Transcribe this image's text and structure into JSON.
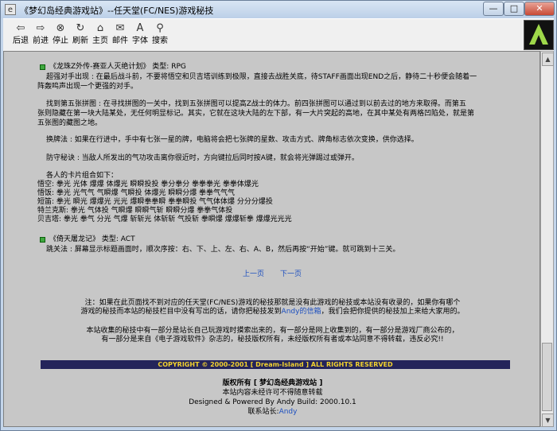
{
  "window": {
    "title": "《梦幻岛经典游戏站》--任天堂(FC/NES)游戏秘技",
    "minimize": "—",
    "maximize": "□",
    "close": "✕"
  },
  "toolbar": {
    "back": "后退",
    "forward": "前进",
    "stop": "停止",
    "refresh": "刷新",
    "home": "主页",
    "mail": "邮件",
    "font": "字体",
    "search": "搜索"
  },
  "article1": {
    "heading_title": "《龙珠Z外传-赛亚人灭绝计划》",
    "heading_type": "类型: RPG",
    "p1_l1": "超强对手出现 : 在最后战斗前，不要将悟空和贝吉塔训练到极限，直接去战胜关底，待STAFF画面出现END之后，静待二十秒便会随着一",
    "p1_l2": "阵轰鸣声出现一个更强的对手。",
    "p2_l1": "找到第五张拼图 : 在寻找拼图的一关中，找到五张拼图可以提高Z战士的体力。前四张拼图可以通过到以前去过的地方来取得。而第五",
    "p2_l2": "张则隐藏在第一块大陆某处，无任何明显标记。其实，它就在这块大陆的左下部，有一大片突起的高地，在其中某处有两格凹陷处，就是第",
    "p2_l3": "五张图的藏图之地。",
    "p3": "换牌法 : 如果在行进中，手中有七张一星的牌，电脑将会把七张牌的星数、攻击方式、牌角标志依次变换，供你选择。",
    "p4": "防守秘诀 : 当敌人所发出的气功攻击离你很近时，方向键拉后同时按A键，就会将光弹踢过或弹开。",
    "combo_intro": "各人的卡片组合如下：",
    "combos": [
      "悟空: 拳光 光体 爆爆 体爆光 瞬瞬投投 拳分拳分 拳拳拳光 拳拳体爆光",
      "悟饭: 拳光 光气气 气瞬爆 气瞬投 体爆光 瞬瞬分爆 拳拳气气气",
      "短笛: 拳光 瞬光 爆爆光 光光 爆瞬拳拳瞬 拳拳瞬投 气气体体爆 分分分爆投",
      "特兰克斯: 拳光 气体投 气瞬爆 瞬瞬气斩 瞬瞬分爆 拳拳气体投",
      "贝吉塔: 拳光 拳气 分光 气爆 斩斩光 体斩斩 气投斩 拳瞬爆 爆爆斩拳 爆爆光光光"
    ]
  },
  "article2": {
    "heading_title": "《倚天屠龙记》",
    "heading_type": "类型: ACT",
    "p1": "跳关法 : 屏幕显示标题画面时，顺次序按：右、下、上、左、右、A、B，然后再按“开始”键。就可跳到十三关。"
  },
  "pager": {
    "prev": "上一页",
    "next": "下一页"
  },
  "note": {
    "l1": "注：如果在此页面找不到对应的任天堂(FC/NES)游戏的秘技那就是没有此游戏的秘技或本站没有收录的，如果你有哪个",
    "l2_a": "游戏的秘技而本站的秘技栏目中没有写出的话，请你把秘技发到",
    "l2_link": "Andy的信箱",
    "l2_b": "，我们会把你提供的秘技加上来给大家用的。",
    "l3": "本站收集的秘技中有一部分是站长自己玩游戏时摸索出来的，有一部分是网上收集到的，有一部分是游戏厂商公布的，",
    "l4": "有一部分是来自《电子游戏软件》杂志的，秘技版权所有，未经版权所有者或本站同意不得转载，违反必究!!"
  },
  "footer": {
    "copyright": "COPYRIGHT © 2000-2001 [ Dream-Island ] ALL RIGHTS RESERVED",
    "rights_a": "版权所有",
    "rights_b": "[ 梦幻岛经典游戏站 ]",
    "notice": "本站内容未经许可不得随意转载",
    "designed": "Designed & Powered By Andy Build: 2000.10.1",
    "contact_label": "联系站长:",
    "contact_name": "Andy"
  }
}
